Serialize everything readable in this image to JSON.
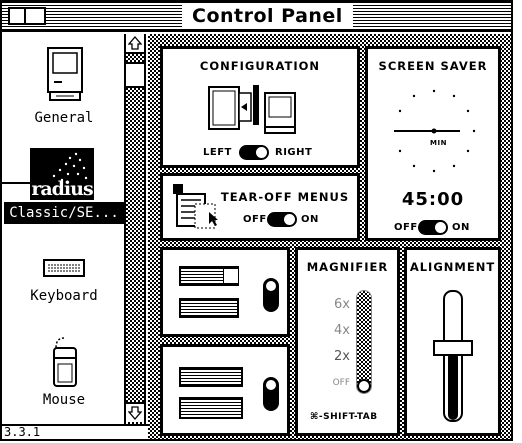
{
  "window": {
    "title": "Control Panel"
  },
  "sidebar": {
    "items": [
      {
        "label": "General",
        "icon": "computer-icon"
      },
      {
        "label": "radius",
        "sublabel": "Classic/SE...",
        "icon": "radius-logo-icon",
        "selected": true
      },
      {
        "label": "Keyboard",
        "icon": "keyboard-icon"
      },
      {
        "label": "Mouse",
        "icon": "mouse-icon"
      }
    ]
  },
  "status": {
    "version": "3.3.1"
  },
  "panels": {
    "configuration": {
      "title": "CONFIGURATION",
      "left": "LEFT",
      "right": "RIGHT"
    },
    "screen_saver": {
      "title": "SCREEN SAVER",
      "clock_label": "MIN",
      "time": "45:00",
      "off": "OFF",
      "on": "ON"
    },
    "tearoff": {
      "title": "TEAR-OFF MENUS",
      "off": "OFF",
      "on": "ON"
    },
    "magnifier": {
      "title": "MAGNIFIER",
      "levels": [
        "6x",
        "4x",
        "2x",
        "OFF"
      ],
      "shortcut": "⌘-SHIFT-TAB"
    },
    "alignment": {
      "title": "ALIGNMENT"
    }
  }
}
